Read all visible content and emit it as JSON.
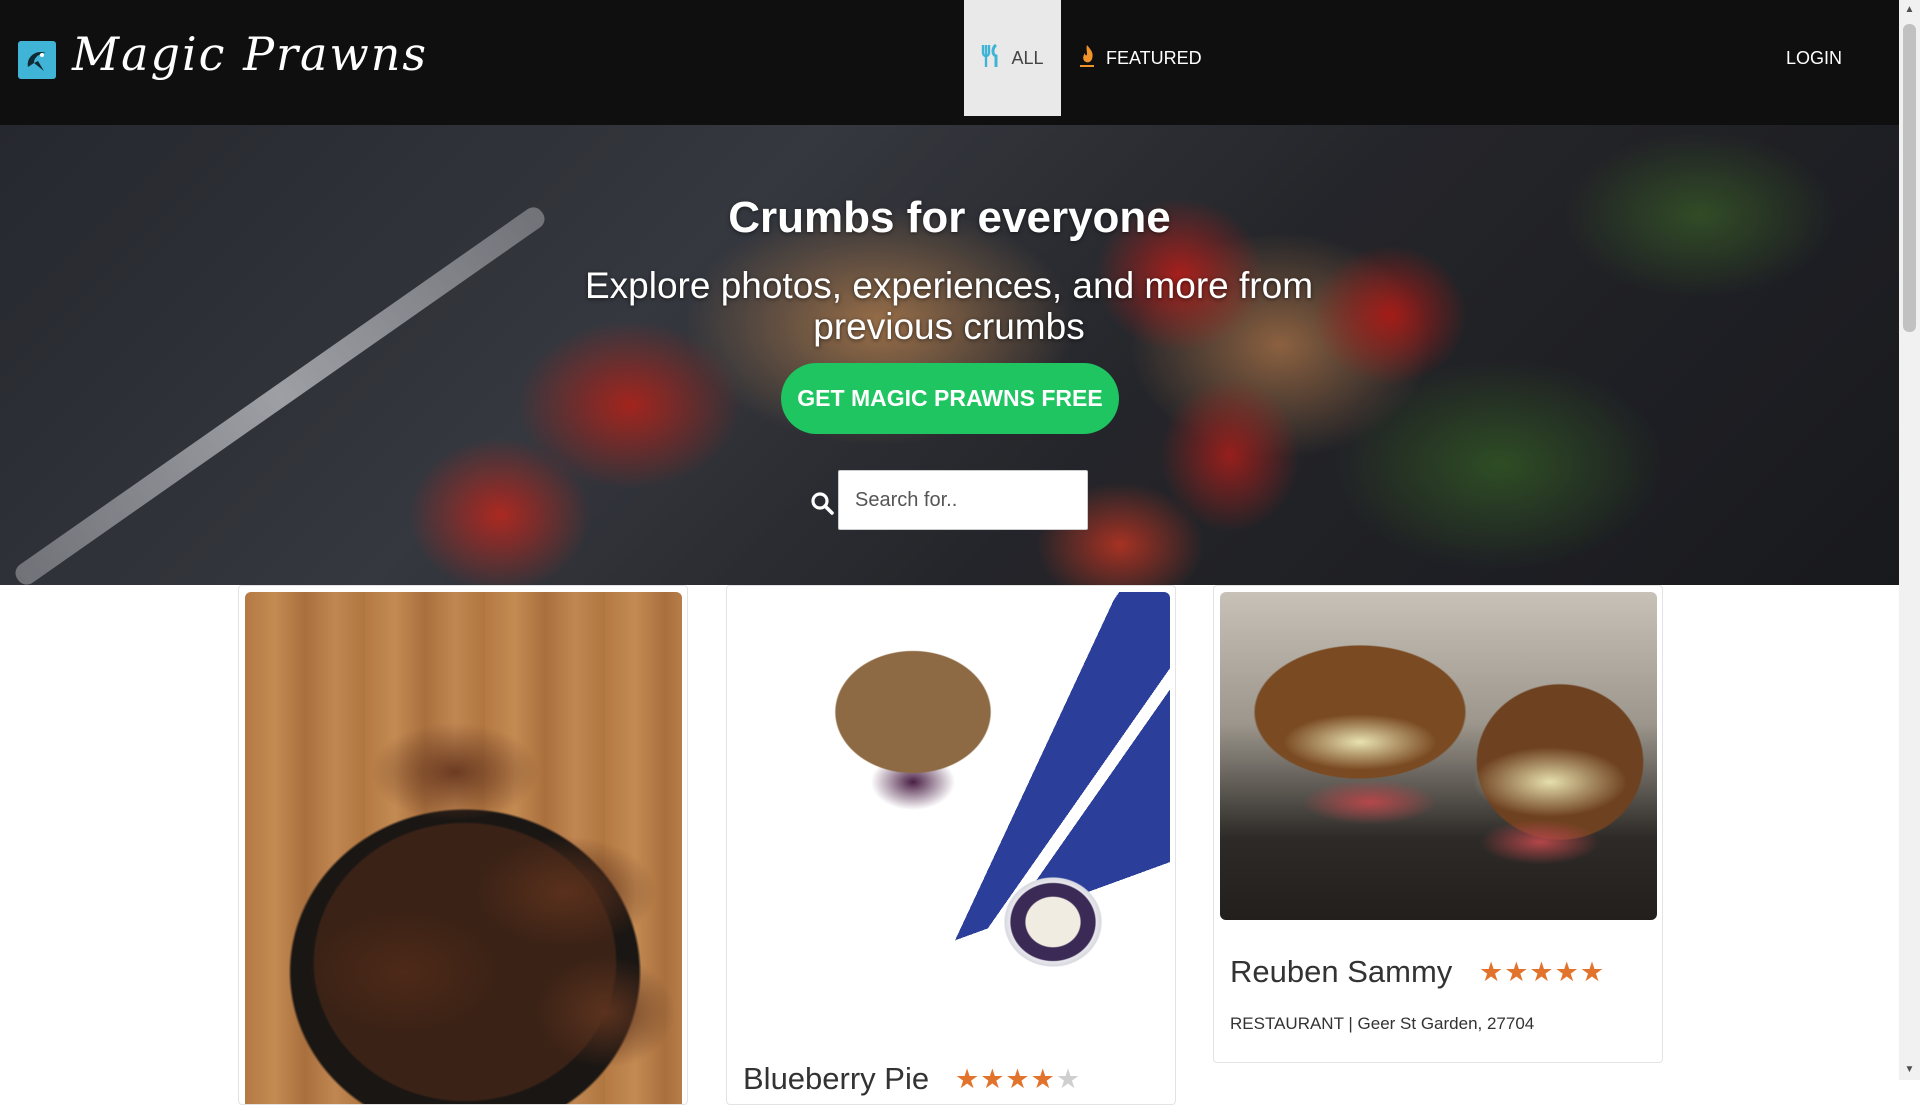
{
  "brand": {
    "name": "Magic Prawns",
    "logo_icon": "prawn-logo-icon",
    "logo_color": "#40b4d6"
  },
  "nav": {
    "tabs": [
      {
        "label": "ALL",
        "icon": "utensils-icon",
        "icon_color": "#40b4d6",
        "active": true
      },
      {
        "label": "FEATURED",
        "icon": "fire-icon",
        "icon_color": "#f0932b",
        "active": false
      }
    ],
    "login_label": "LOGIN"
  },
  "hero": {
    "title": "Crumbs for everyone",
    "subtitle": "Explore photos, experiences, and more from previous crumbs",
    "cta_label": "GET MAGIC PRAWNS FREE",
    "cta_color": "#1ec561",
    "search_placeholder": "Search for.."
  },
  "cards": [
    {
      "title": "",
      "image": "brownies-photo",
      "rating": null,
      "meta": ""
    },
    {
      "title": "Blueberry Pie",
      "image": "blueberry-crumble-photo",
      "rating": 4,
      "max_rating": 5,
      "meta": ""
    },
    {
      "title": "Reuben Sammy",
      "image": "reuben-sandwich-photo",
      "rating": 5,
      "max_rating": 5,
      "meta": "RESTAURANT | Geer St Garden, 27704"
    }
  ],
  "colors": {
    "navbar": "#0f0f0f",
    "star_on": "#e2732c",
    "star_off": "#cfcfcf"
  },
  "stars": {
    "full": "★★★★★",
    "four_on": "★★★★",
    "one_off": "★"
  }
}
